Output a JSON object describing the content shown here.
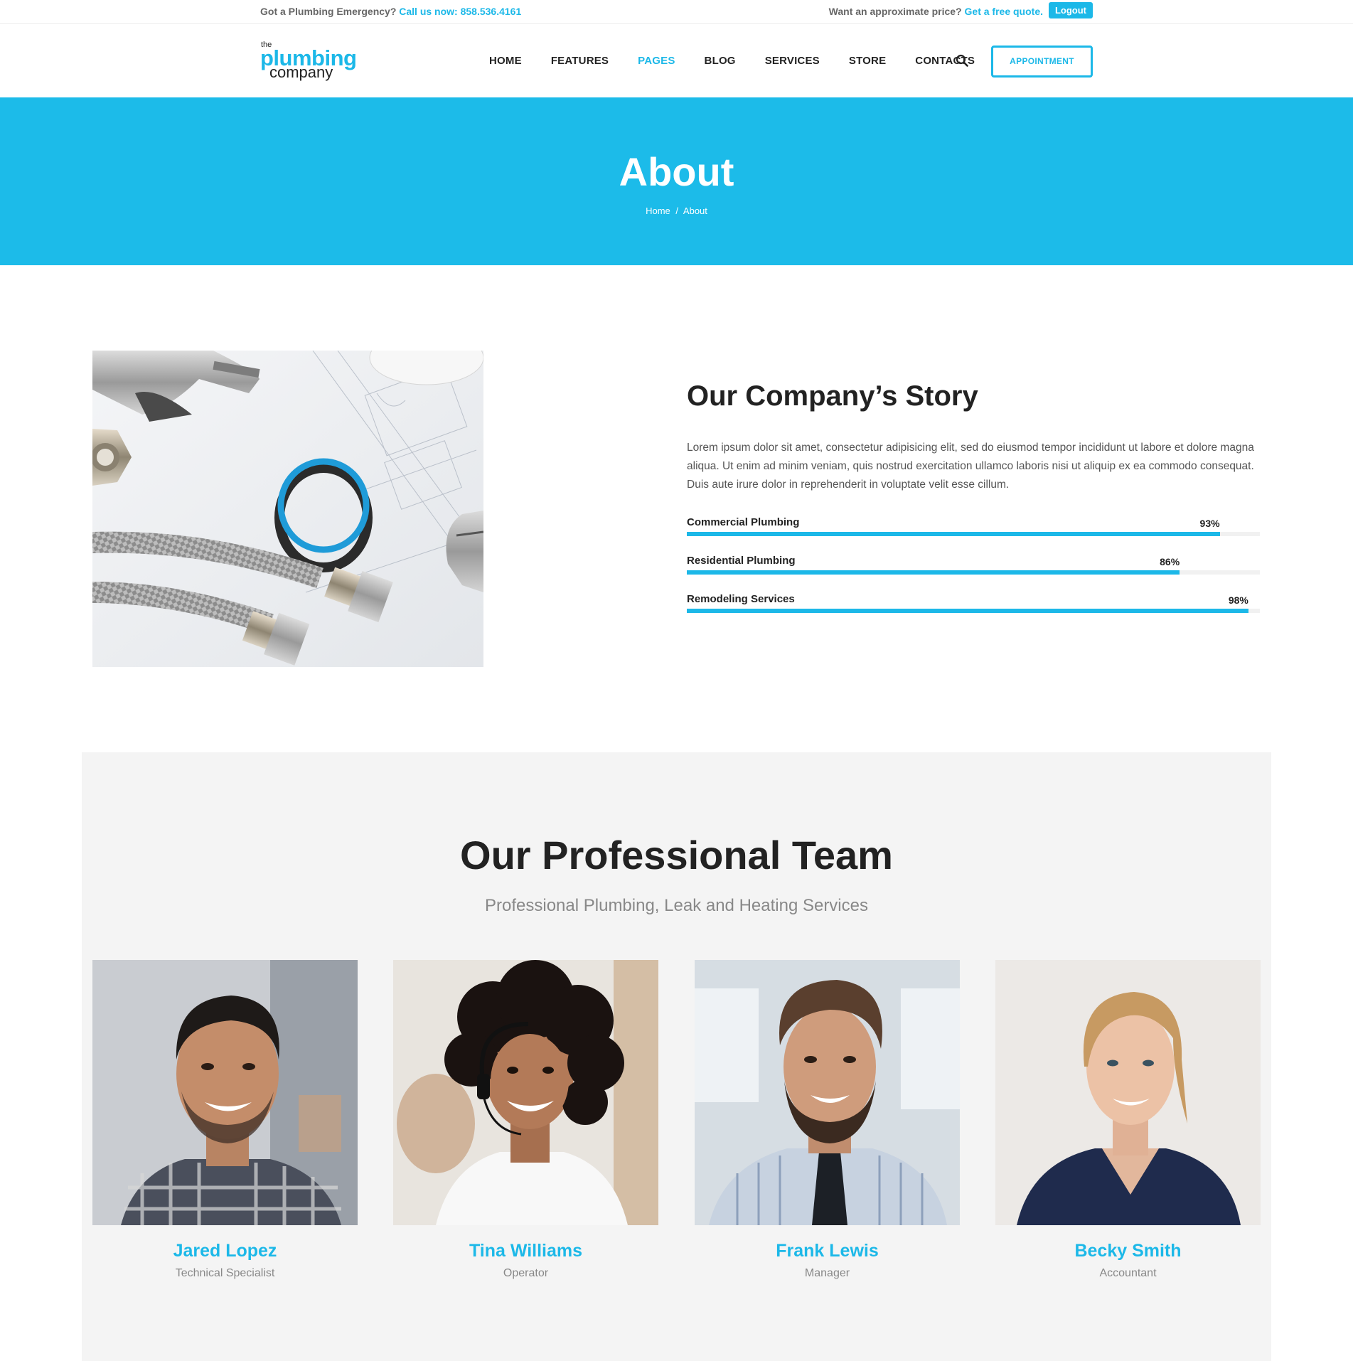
{
  "topbar": {
    "emergency_text": "Got a Plumbing Emergency?",
    "call_link": "Call us now: 858.536.4161",
    "price_text": "Want an approximate price?",
    "quote_link": "Get a free quote.",
    "logout_label": "Logout"
  },
  "logo": {
    "the": "the",
    "plumbing": "plumbing",
    "company": "company"
  },
  "nav": {
    "items": [
      "HOME",
      "FEATURES",
      "PAGES",
      "BLOG",
      "SERVICES",
      "STORE",
      "CONTACTS"
    ],
    "active": "PAGES",
    "search_icon": "search-icon",
    "appointment_label": "APPOINTMENT"
  },
  "hero": {
    "title": "About",
    "breadcrumb_home": "Home",
    "breadcrumb_sep": "/",
    "breadcrumb_current": "About"
  },
  "story": {
    "title": "Our Company’s Story",
    "text": "Lorem ipsum dolor sit amet, consectetur adipisicing elit, sed do eiusmod tempor incididunt ut labore et dolore magna aliqua. Ut enim ad minim veniam, quis nostrud exercitation ullamco laboris nisi ut aliquip ex ea commodo consequat. Duis aute irure dolor in reprehenderit in voluptate velit esse cillum.",
    "skills": [
      {
        "label": "Commercial Plumbing",
        "percent": 93,
        "percent_label": "93%"
      },
      {
        "label": "Residential Plumbing",
        "percent": 86,
        "percent_label": "86%"
      },
      {
        "label": "Remodeling Services",
        "percent": 98,
        "percent_label": "98%"
      }
    ]
  },
  "team": {
    "title": "Our Professional Team",
    "subtitle": "Professional Plumbing, Leak and Heating Services",
    "members": [
      {
        "name": "Jared Lopez",
        "role": "Technical Specialist"
      },
      {
        "name": "Tina Williams",
        "role": "Operator"
      },
      {
        "name": "Frank Lewis",
        "role": "Manager"
      },
      {
        "name": "Becky Smith",
        "role": "Accountant"
      }
    ]
  },
  "colors": {
    "accent": "#1cb8e8",
    "hero_bg": "#1cbbe9",
    "team_bg": "#f4f4f4"
  }
}
